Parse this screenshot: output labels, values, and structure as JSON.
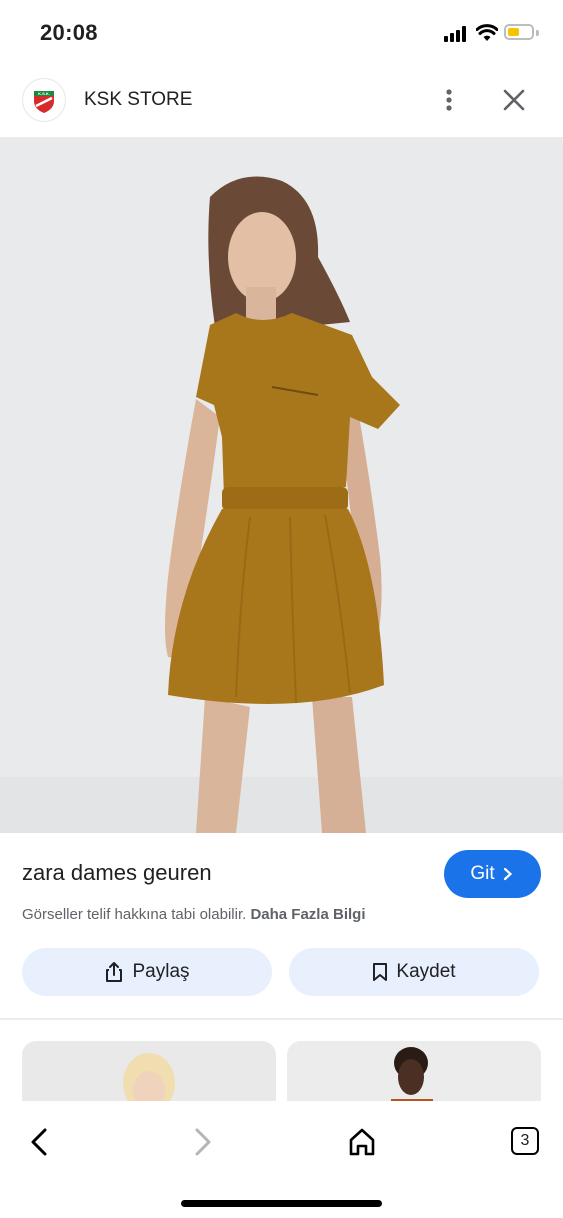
{
  "status_bar": {
    "time": "20:08"
  },
  "header": {
    "store_name": "KSK STORE",
    "logo_text": "K.S.K."
  },
  "result": {
    "title": "zara dames geuren",
    "go_button": "Git",
    "copyright_text": "Görseller telif hakkına tabi olabilir.",
    "more_info_link": "Daha Fazla Bilgi"
  },
  "actions": {
    "share_label": "Paylaş",
    "save_label": "Kaydet"
  },
  "toolbar": {
    "tab_count": "3"
  },
  "colors": {
    "accent": "#1a73e8",
    "pill_bg": "#e8f0fe",
    "dress": "#a8761b"
  },
  "icons": [
    "signal-icon",
    "wifi-icon",
    "battery-icon",
    "more-vert-icon",
    "close-icon",
    "chevron-right-icon",
    "share-icon",
    "bookmark-icon",
    "back-icon",
    "forward-icon",
    "home-icon",
    "tabs-icon"
  ]
}
